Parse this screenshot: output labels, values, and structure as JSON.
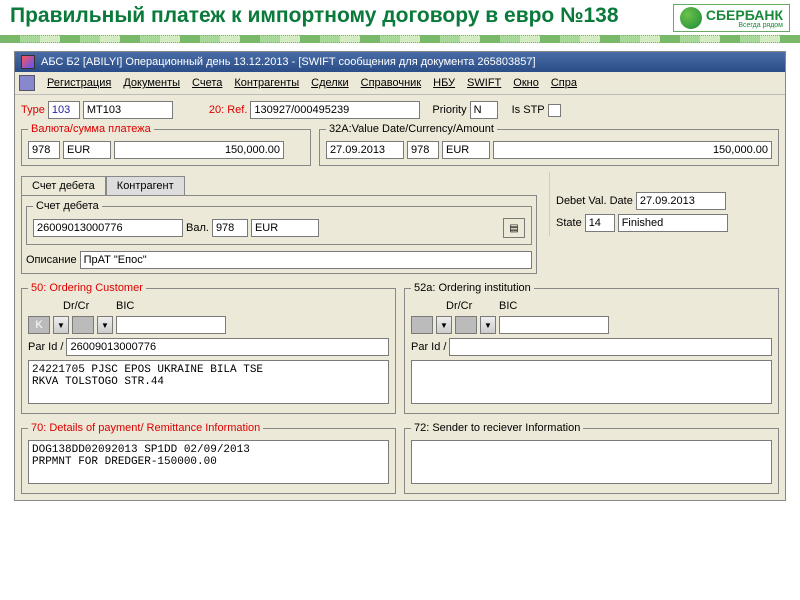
{
  "header": {
    "title": "Правильный платеж к импортному договору в евро №138",
    "logo_text": "СБЕРБАНК",
    "logo_sub": "Всегда рядом"
  },
  "window": {
    "title": "АБС Б2 [ABILYI] Операционный день 13.12.2013 - [SWIFT сообщения для документа 265803857]"
  },
  "menu": {
    "registration": "Регистрация",
    "documents": "Документы",
    "accounts": "Счета",
    "contragents": "Контрагенты",
    "deals": "Сделки",
    "reference": "Справочник",
    "nbu": "НБУ",
    "swift": "SWIFT",
    "window": "Окно",
    "help": "Спра"
  },
  "top": {
    "type_label": "Type",
    "type_code": "103",
    "type_name": "MT103",
    "ref_label": "20: Ref.",
    "ref_value": "130927/000495239",
    "priority_label": "Priority",
    "priority_value": "N",
    "is_stp_label": "Is STP"
  },
  "currency_amount": {
    "legend": "Валюта/сумма платежа",
    "code": "978",
    "cur": "EUR",
    "amount": "150,000.00"
  },
  "field32a": {
    "legend": "32A:Value Date/Currency/Amount",
    "date": "27.09.2013",
    "code": "978",
    "cur": "EUR",
    "amount": "150,000.00"
  },
  "tab_debit": "Счет дебета",
  "tab_contragent": "Контрагент",
  "debit_account": {
    "legend": "Счет дебета",
    "account": "26009013000776",
    "val_label": "Вал.",
    "code": "978",
    "cur": "EUR"
  },
  "desc_label": "Описание",
  "desc_value": "ПрАТ \"Епос\"",
  "right_panel": {
    "debet_val_date_label": "Debet Val. Date",
    "debet_val_date": "27.09.2013",
    "state_label": "State",
    "state_code": "14",
    "state_text": "Finished"
  },
  "ordering_customer": {
    "legend": "50: Ordering Customer",
    "drcr": "Dr/Cr",
    "bic": "BIC",
    "k": "K",
    "par_id_label": "Par Id /",
    "par_id": "26009013000776",
    "body": "24221705 PJSC EPOS UKRAINE BILA TSE\nRKVA TOLSTOGO STR.44"
  },
  "ordering_institution": {
    "legend": "52a: Ordering institution",
    "drcr": "Dr/Cr",
    "bic": "BIC",
    "par_id_label": "Par Id /",
    "par_id": "",
    "body": ""
  },
  "field70": {
    "legend": "70: Details of payment/ Remittance Information",
    "body": "DOG138DD02092013 SP1DD 02/09/2013\nPRPMNT FOR DREDGER-150000.00"
  },
  "field72": {
    "legend": "72: Sender to reciever Information",
    "body": ""
  }
}
